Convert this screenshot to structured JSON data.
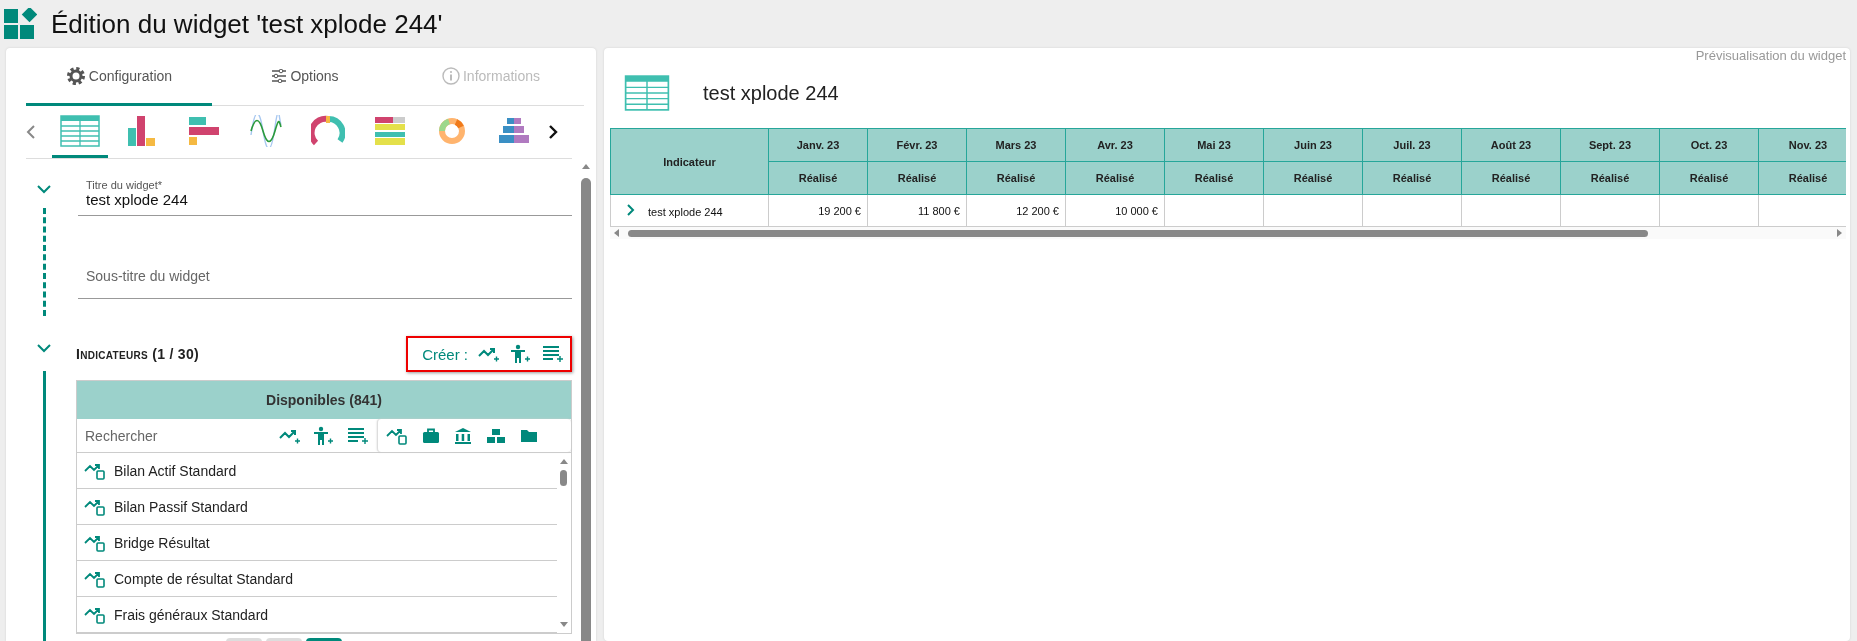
{
  "window": {
    "title": "Édition du widget 'test xplode 244'"
  },
  "tabs": [
    {
      "label": "Configuration",
      "kind": "gear",
      "selected": true,
      "disabled": false
    },
    {
      "label": "Options",
      "kind": "sliders",
      "selected": false,
      "disabled": false
    },
    {
      "label": "Informations",
      "kind": "info",
      "selected": false,
      "disabled": true
    }
  ],
  "chart_types": [
    {
      "kind": "table",
      "selected": true
    },
    {
      "kind": "bars",
      "selected": false
    },
    {
      "kind": "hbars",
      "selected": false
    },
    {
      "kind": "wave",
      "selected": false
    },
    {
      "kind": "gauge",
      "selected": false
    },
    {
      "kind": "stacked",
      "selected": false
    },
    {
      "kind": "donut",
      "selected": false
    },
    {
      "kind": "pyramid",
      "selected": false
    }
  ],
  "fields": [
    {
      "label": "Titre du widget*",
      "value": "test xplode 244"
    },
    {
      "placeholder": "Sous-titre du widget"
    }
  ],
  "indicators": {
    "title": "Indicateurs (1 / 30)",
    "create_label": "Créer :",
    "available_title": "Disponibles (841)",
    "search_placeholder": "Rechercher",
    "items": [
      "Bilan Actif Standard",
      "Bilan Passif Standard",
      "Bridge Résultat",
      "Compte de résultat Standard",
      "Frais généraux Standard"
    ],
    "pages": [
      {
        "selected": false
      },
      {
        "selected": false
      },
      {
        "selected": true
      }
    ]
  },
  "preview": {
    "label": "Prévisualisation du widget",
    "title": "test xplode 244",
    "table": {
      "first_column": "Indicateur",
      "columns": [
        {
          "month": "Janv. 23",
          "sub": "Réalisé"
        },
        {
          "month": "Févr. 23",
          "sub": "Réalisé"
        },
        {
          "month": "Mars 23",
          "sub": "Réalisé"
        },
        {
          "month": "Avr. 23",
          "sub": "Réalisé"
        },
        {
          "month": "Mai 23",
          "sub": "Réalisé"
        },
        {
          "month": "Juin 23",
          "sub": "Réalisé"
        },
        {
          "month": "Juil. 23",
          "sub": "Réalisé"
        },
        {
          "month": "Août 23",
          "sub": "Réalisé"
        },
        {
          "month": "Sept. 23",
          "sub": "Réalisé"
        },
        {
          "month": "Oct. 23",
          "sub": "Réalisé"
        },
        {
          "month": "Nov. 23",
          "sub": "Réalisé"
        }
      ],
      "rows": [
        {
          "name": "test xplode 244",
          "expanded": false,
          "values": [
            "19 200 €",
            "11 800 €",
            "12 200 €",
            "10 000 €"
          ]
        }
      ]
    }
  }
}
